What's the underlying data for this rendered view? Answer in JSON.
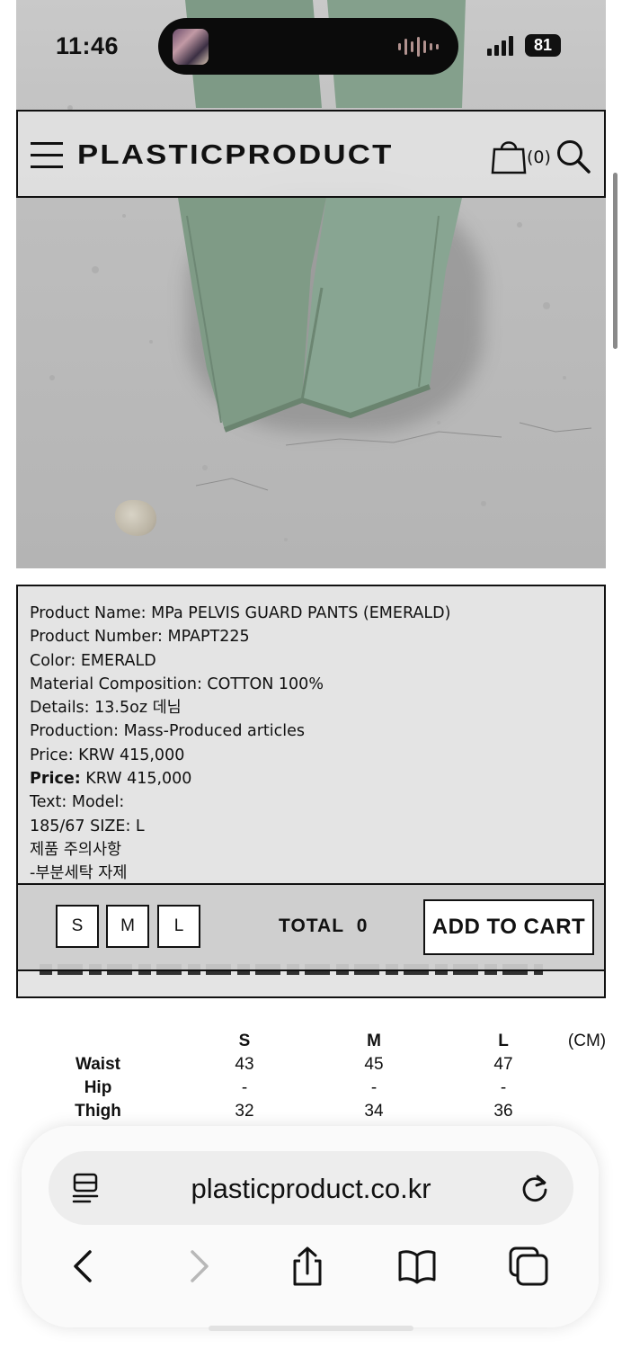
{
  "status_bar": {
    "time": "11:46",
    "battery": "81"
  },
  "header": {
    "logo": "PLASTICPRODUCT",
    "cart_count": "(0)"
  },
  "product_info": {
    "lines": [
      {
        "label": "Product Name:",
        "value": "MPa PELVIS GUARD PANTS (EMERALD)"
      },
      {
        "label": "Product Number:",
        "value": "MPAPT225"
      },
      {
        "label": "Color:",
        "value": "EMERALD"
      },
      {
        "label": "Material Composition:",
        "value": "COTTON 100%"
      },
      {
        "label": "Details:",
        "value": "13.5oz 데님"
      },
      {
        "label": "Production:",
        "value": "Mass-Produced articles"
      },
      {
        "label": "Price:",
        "value": "KRW 415,000"
      },
      {
        "label": "Price:",
        "value": "KRW 415,000"
      },
      {
        "label": "Text:",
        "value": "Model:"
      }
    ],
    "model_size": "185/67 SIZE: L",
    "care_title": "제품 주의사항",
    "care_line": "-부분세탁 자제"
  },
  "purchase_bar": {
    "sizes": [
      "S",
      "M",
      "L"
    ],
    "total_label": "TOTAL",
    "total_value": "0",
    "add_to_cart": "ADD TO CART"
  },
  "size_chart": {
    "columns": [
      "S",
      "M",
      "L"
    ],
    "unit": "(CM)",
    "rows": [
      {
        "label": "Waist",
        "values": [
          "43",
          "45",
          "47"
        ]
      },
      {
        "label": "Hip",
        "values": [
          "-",
          "-",
          "-"
        ]
      },
      {
        "label": "Thigh",
        "values": [
          "32",
          "34",
          "36"
        ]
      }
    ]
  },
  "browser": {
    "url": "plasticproduct.co.kr",
    "icons": [
      "reader-icon",
      "reload-icon",
      "back-icon",
      "forward-icon",
      "share-icon",
      "bookmarks-icon",
      "tabs-icon"
    ]
  }
}
